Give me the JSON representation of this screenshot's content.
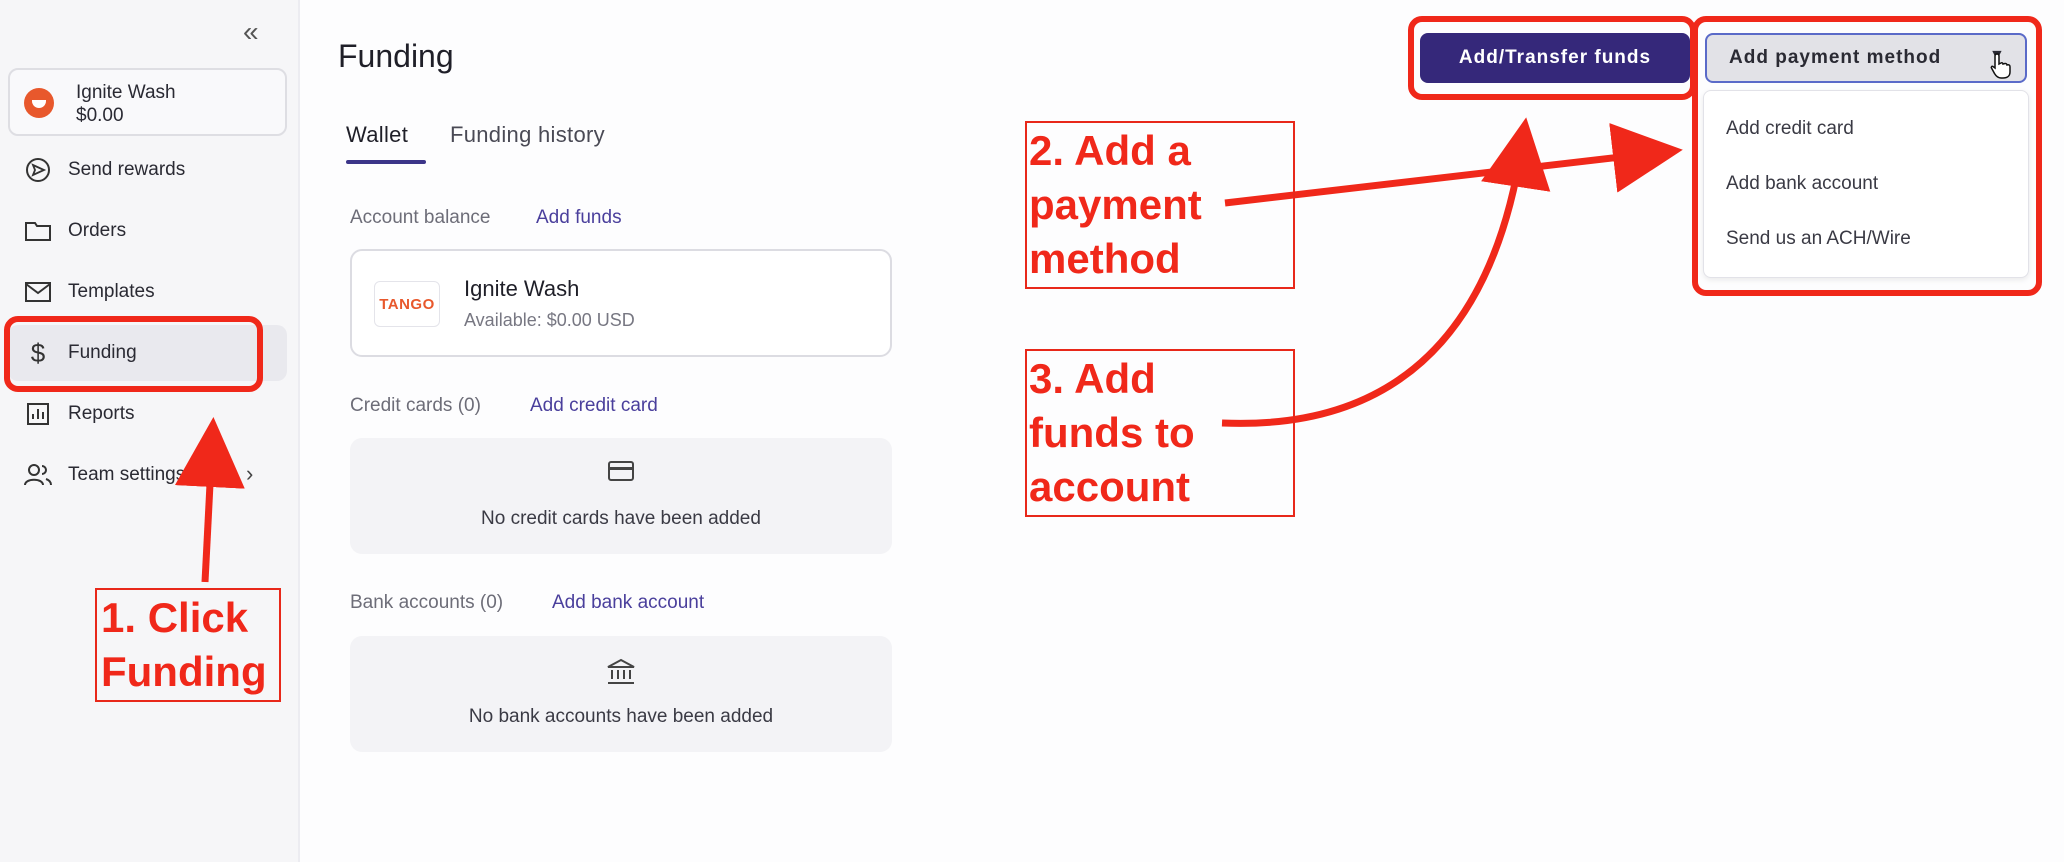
{
  "sidebar": {
    "account": {
      "name": "Ignite Wash",
      "balance": "$0.00"
    },
    "items": [
      {
        "label": "Send rewards",
        "icon": "send-icon"
      },
      {
        "label": "Orders",
        "icon": "folder-icon"
      },
      {
        "label": "Templates",
        "icon": "mail-icon"
      },
      {
        "label": "Funding",
        "icon": "dollar-icon"
      },
      {
        "label": "Reports",
        "icon": "chart-icon"
      },
      {
        "label": "Team settings",
        "icon": "team-icon"
      }
    ]
  },
  "main": {
    "title": "Funding",
    "tabs": [
      {
        "label": "Wallet"
      },
      {
        "label": "Funding history"
      }
    ],
    "account_balance": {
      "label": "Account balance",
      "link": "Add funds"
    },
    "wallet": {
      "logo_text": "TANGO",
      "name": "Ignite Wash",
      "available": "Available: $0.00 USD"
    },
    "credit_cards": {
      "label": "Credit cards (0)",
      "link": "Add credit card",
      "empty": "No credit cards have been added"
    },
    "bank_accounts": {
      "label": "Bank accounts (0)",
      "link": "Add bank account",
      "empty": "No bank accounts have been added"
    }
  },
  "header": {
    "transfer_label": "Add/Transfer funds",
    "payment_method_label": "Add payment method",
    "dropdown": [
      "Add credit card",
      "Add bank account",
      "Send us an ACH/Wire"
    ]
  },
  "annotations": {
    "step1": [
      "1. Click",
      "Funding"
    ],
    "step2": [
      "2. Add a",
      "payment",
      "method"
    ],
    "step3": [
      "3. Add",
      "funds to",
      "account"
    ]
  },
  "colors": {
    "accent": "#35287a",
    "link": "#4a3f9c",
    "annotation": "#f0281a",
    "brand": "#e8582c"
  }
}
